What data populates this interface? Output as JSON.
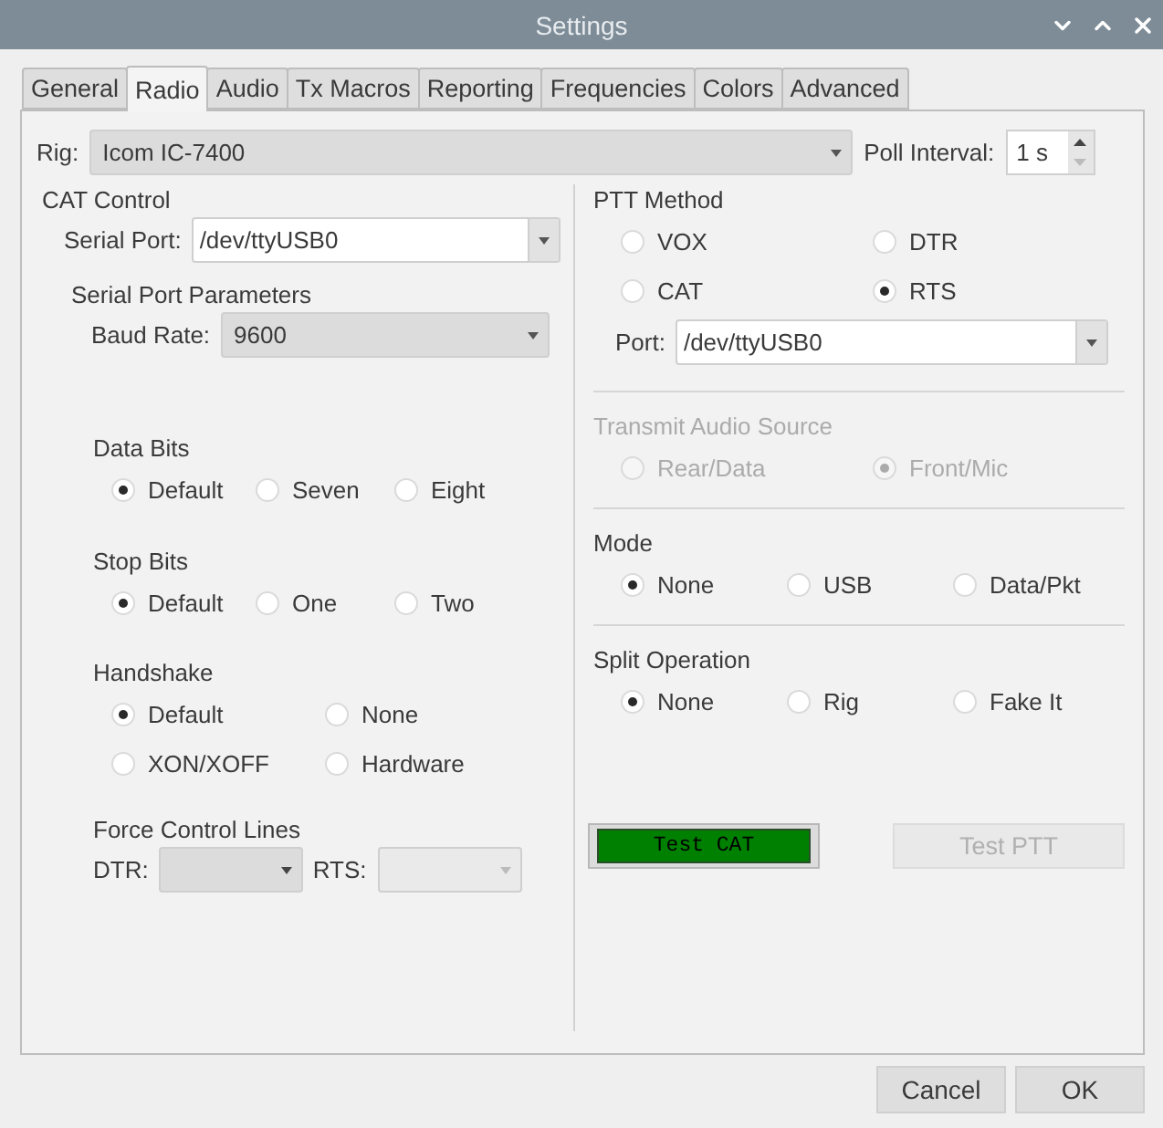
{
  "window": {
    "title": "Settings"
  },
  "tabs": [
    {
      "label": "General",
      "selected": false
    },
    {
      "label": "Radio",
      "selected": true
    },
    {
      "label": "Audio",
      "selected": false
    },
    {
      "label": "Tx Macros",
      "selected": false
    },
    {
      "label": "Reporting",
      "selected": false
    },
    {
      "label": "Frequencies",
      "selected": false
    },
    {
      "label": "Colors",
      "selected": false
    },
    {
      "label": "Advanced",
      "selected": false
    }
  ],
  "rig": {
    "label": "Rig:",
    "value": "Icom  IC-7400"
  },
  "poll_interval": {
    "label": "Poll Interval:",
    "value": "1 s"
  },
  "cat_control": {
    "title": "CAT Control",
    "serial_port": {
      "label": "Serial Port:",
      "value": "/dev/ttyUSB0"
    },
    "serial_port_parameters": {
      "title": "Serial Port Parameters",
      "baud_rate": {
        "label": "Baud Rate:",
        "value": "9600"
      }
    },
    "groups": [
      {
        "title": "Data Bits",
        "options": [
          {
            "label": "Default",
            "selected": true
          },
          {
            "label": "Seven",
            "selected": false
          },
          {
            "label": "Eight",
            "selected": false
          }
        ]
      },
      {
        "title": "Stop Bits",
        "options": [
          {
            "label": "Default",
            "selected": true
          },
          {
            "label": "One",
            "selected": false
          },
          {
            "label": "Two",
            "selected": false
          }
        ]
      },
      {
        "title": "Handshake",
        "options": [
          {
            "label": "Default",
            "selected": true
          },
          {
            "label": "None",
            "selected": false
          },
          {
            "label": "XON/XOFF",
            "selected": false
          },
          {
            "label": "Hardware",
            "selected": false
          }
        ]
      }
    ],
    "force_control_lines": {
      "title": "Force Control Lines",
      "lines": [
        {
          "label": "DTR:",
          "disabled": false
        },
        {
          "label": "RTS:",
          "disabled": true
        }
      ]
    }
  },
  "ptt_method": {
    "title": "PTT Method",
    "options": [
      {
        "label": "VOX",
        "selected": false
      },
      {
        "label": "DTR",
        "selected": false
      },
      {
        "label": "CAT",
        "selected": false
      },
      {
        "label": "RTS",
        "selected": true
      }
    ],
    "port": {
      "label": "Port:",
      "value": "/dev/ttyUSB0"
    }
  },
  "right_groups": [
    {
      "title": "Transmit Audio Source",
      "disabled": true,
      "options": [
        {
          "label": "Rear/Data",
          "selected": false
        },
        {
          "label": "Front/Mic",
          "selected": true
        }
      ]
    },
    {
      "title": "Mode",
      "disabled": false,
      "options": [
        {
          "label": "None",
          "selected": true
        },
        {
          "label": "USB",
          "selected": false
        },
        {
          "label": "Data/Pkt",
          "selected": false
        }
      ]
    },
    {
      "title": "Split Operation",
      "disabled": false,
      "options": [
        {
          "label": "None",
          "selected": true
        },
        {
          "label": "Rig",
          "selected": false
        },
        {
          "label": "Fake It",
          "selected": false
        }
      ]
    }
  ],
  "test_buttons": [
    {
      "label": "Test CAT",
      "active": true,
      "disabled": false
    },
    {
      "label": "Test PTT",
      "active": false,
      "disabled": true
    }
  ],
  "buttons": [
    "Cancel",
    "OK"
  ]
}
